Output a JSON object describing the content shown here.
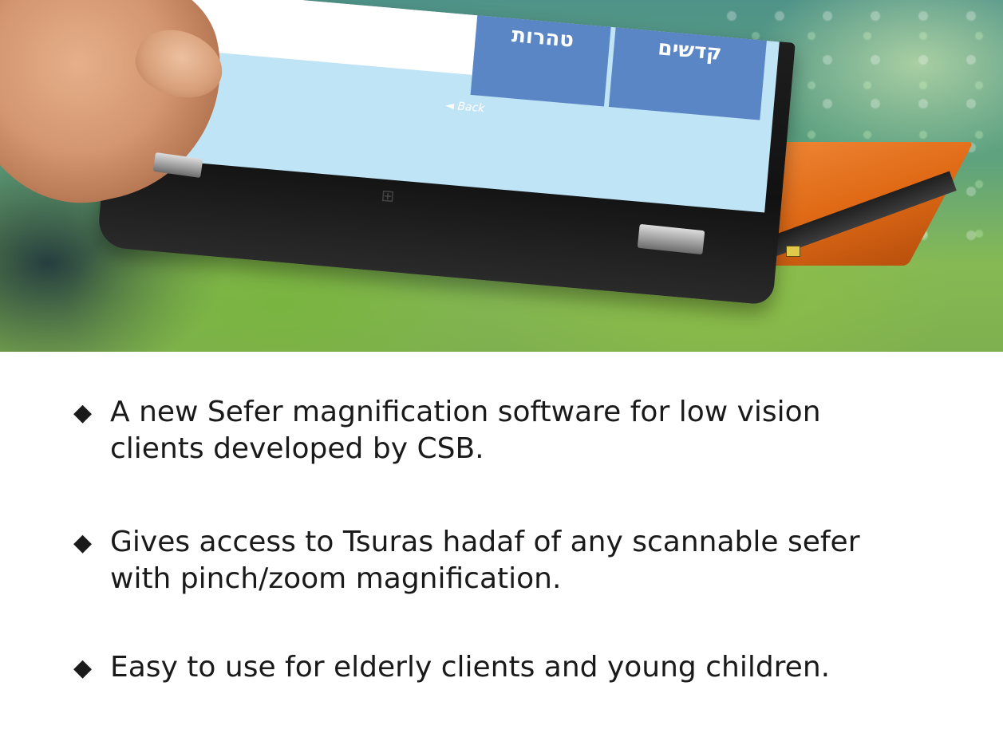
{
  "screen_tiles": {
    "tile_left": "טהרות",
    "tile_right": "קדשים",
    "back_label": "◄ Back"
  },
  "icons": {
    "bullet_marker": "◆",
    "logo": "windows-logo-icon"
  },
  "bullets": [
    {
      "text": "A new Sefer magnification software for low vision\nclients developed by CSB."
    },
    {
      "text": "Gives access to Tsuras hadaf of any scannable sefer\nwith pinch/zoom magnification."
    },
    {
      "text": "Easy to use for elderly clients and young children."
    }
  ],
  "colors": {
    "tile_blue": "#5b86c6",
    "screen_light_blue": "#bfe4f6",
    "laptop_orange": "#e06a16",
    "text": "#1a1a1a"
  }
}
